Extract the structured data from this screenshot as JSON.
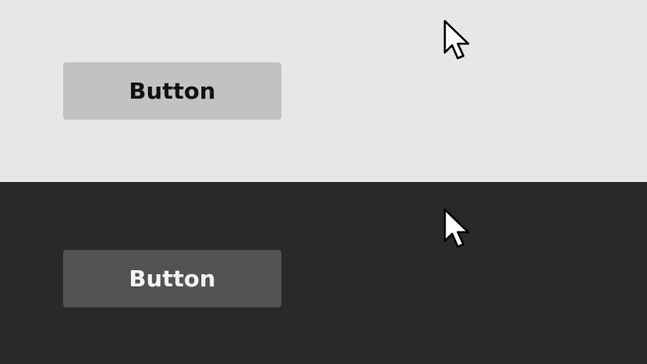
{
  "light_panel": {
    "button_label": "Button",
    "background": "#e8e6e9",
    "button_color": "#c3c1c4",
    "cursor_icon": "arrow-cursor-icon"
  },
  "dark_panel": {
    "button_label": "Button",
    "background": "#2a282b",
    "button_color": "#545255",
    "cursor_icon": "arrow-cursor-icon"
  }
}
